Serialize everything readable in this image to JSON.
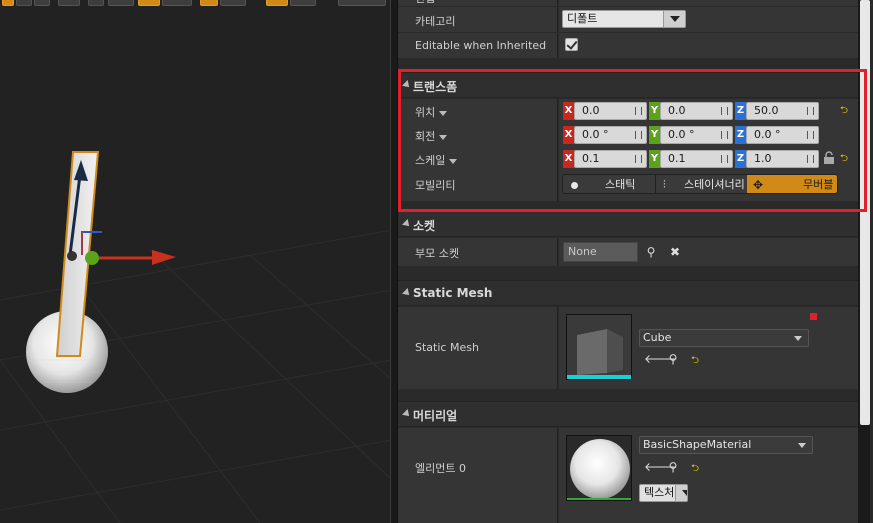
{
  "top_row": {
    "label": "편집"
  },
  "category": {
    "label": "카테고리",
    "value": "디폴트"
  },
  "editable_inherited": {
    "label": "Editable when Inherited",
    "checked": true
  },
  "transform": {
    "title": "트랜스폼",
    "location": {
      "label": "위치",
      "x": "0.0",
      "y": "0.0",
      "z": "50.0"
    },
    "rotation": {
      "label": "회전",
      "x": "0.0 °",
      "y": "0.0 °",
      "z": "0.0 °"
    },
    "scale": {
      "label": "스케일",
      "x": "0.1",
      "y": "0.1",
      "z": "1.0"
    },
    "mobility": {
      "label": "모빌리티",
      "options": [
        "스태틱",
        "스테이셔너리",
        "무버블"
      ],
      "selected": "무버블"
    },
    "axes": {
      "x": "X",
      "y": "Y",
      "z": "Z"
    }
  },
  "socket": {
    "title": "소켓",
    "parent_label": "부모 소켓",
    "parent_value": "None"
  },
  "static_mesh": {
    "title": "Static Mesh",
    "label": "Static Mesh",
    "value": "Cube"
  },
  "materials": {
    "title": "머티리얼",
    "element_label": "엘리먼트 0",
    "value": "BasicShapeMaterial",
    "texture_button": "텍스처"
  },
  "colors": {
    "accent": "#d18a18",
    "highlight": "#e0202a",
    "axis_x": "#c8281e",
    "axis_y": "#5ca31c",
    "axis_z": "#2a72d8"
  }
}
